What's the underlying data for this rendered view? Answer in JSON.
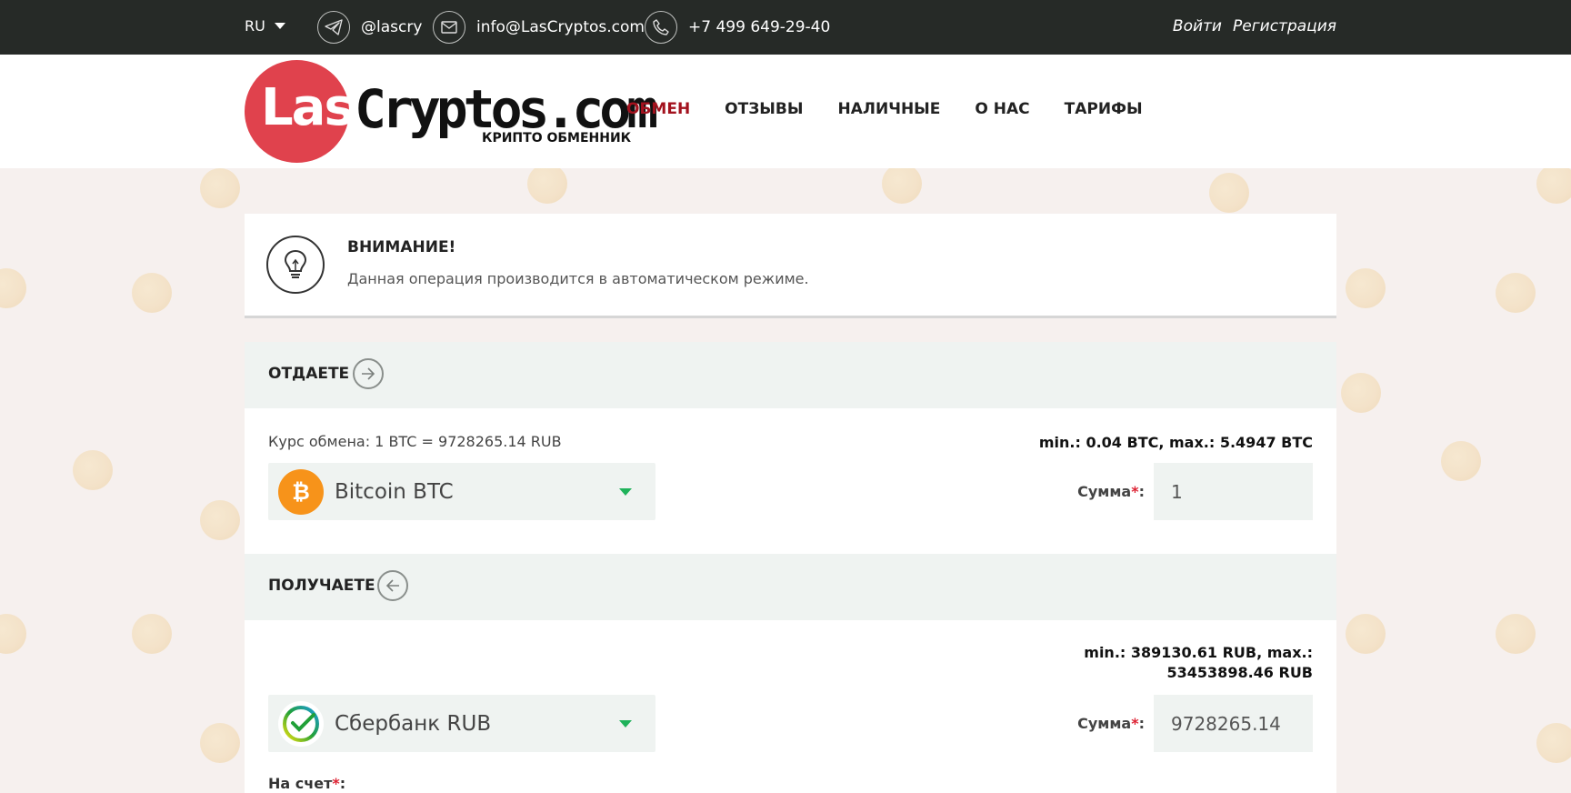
{
  "topbar": {
    "lang": "RU",
    "telegram": "@lascry",
    "email": "info@LasCryptos.com",
    "phone": "+7 499 649-29-40",
    "login": "Войти",
    "register": "Регистрация"
  },
  "header": {
    "logo_las": "Las",
    "logo_cryptos": "Cryptos.com",
    "logo_sub": "КРИПТО ОБМЕННИК",
    "nav": [
      "ОБМЕН",
      "ОТЗЫВЫ",
      "НАЛИЧНЫЕ",
      "О НАС",
      "ТАРИФЫ"
    ]
  },
  "attention": {
    "title": "ВНИМАНИЕ!",
    "text": "Данная операция производится в автоматическом режиме."
  },
  "give": {
    "title": "ОТДАЕТЕ",
    "rate": "Курс обмена: 1 BTC = 9728265.14 RUB",
    "limits": "min.: 0.04 BTC, max.: 5.4947 BTC",
    "currency": "Bitcoin BTC",
    "sum_label": "Сумма",
    "sum_value": "1"
  },
  "get": {
    "title": "ПОЛУЧАЕТЕ",
    "limits_line1": "min.: 389130.61 RUB, max.:",
    "limits_line2": "53453898.46 RUB",
    "currency": "Сбербанк RUB",
    "sum_label": "Сумма",
    "sum_value": "9728265.14",
    "account_label": "На счет"
  },
  "colors": {
    "topbar": "#262a27",
    "accent_red": "#a3121e",
    "logo_red": "#e0424d",
    "section_bg": "#eff3f1",
    "caret_green": "#1fb25a"
  }
}
